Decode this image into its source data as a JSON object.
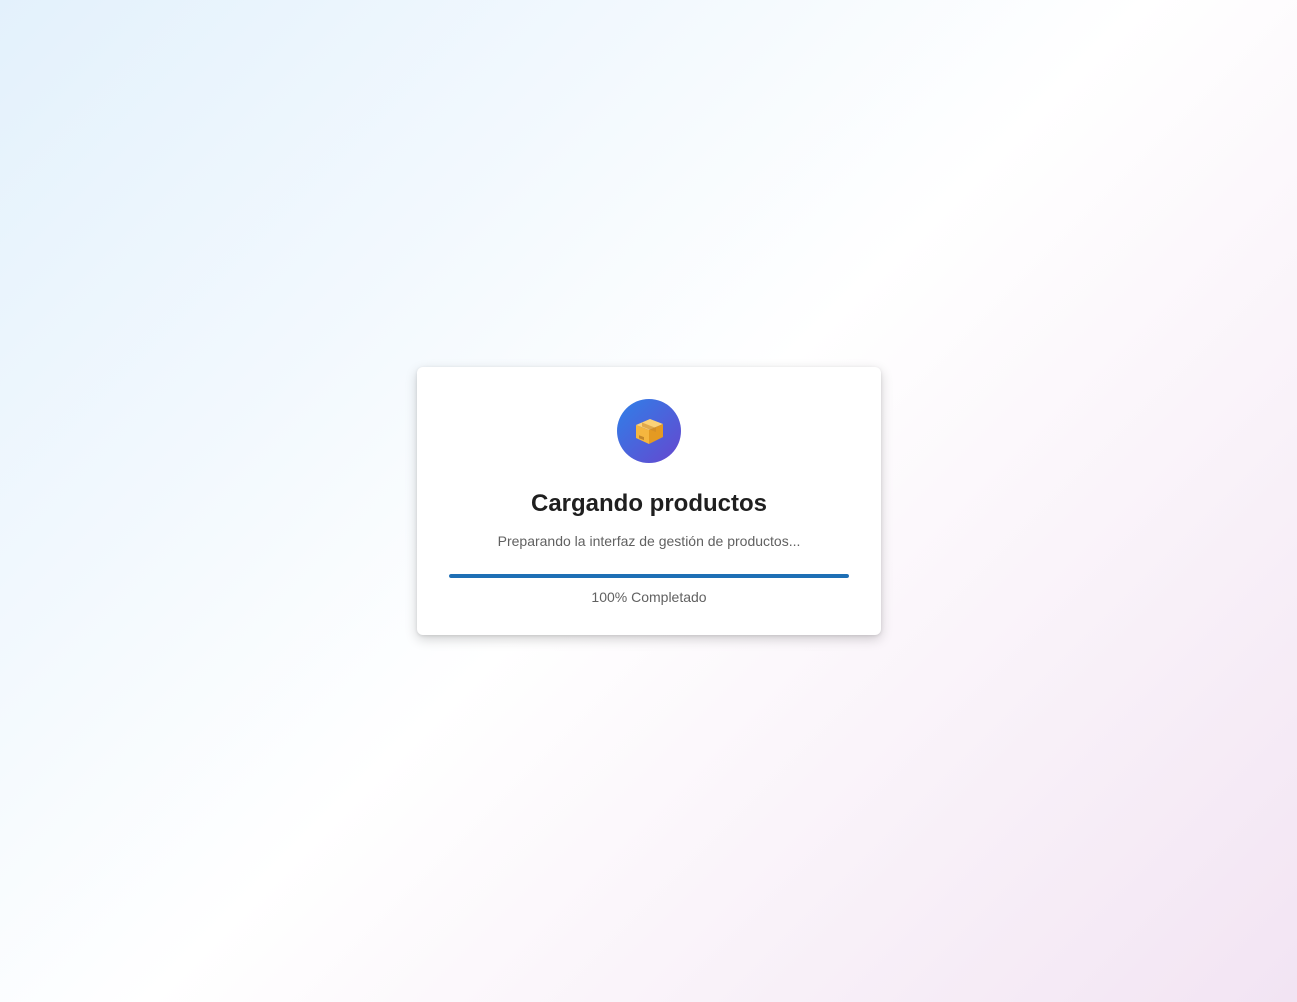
{
  "loader": {
    "icon": "package-icon",
    "title": "Cargando productos",
    "subtitle": "Preparando la interfaz de gestión de productos...",
    "progress": {
      "percent": 100,
      "label": "100% Completado"
    }
  },
  "colors": {
    "accent": "#1e6fb5",
    "icon_gradient_start": "#2f80e8",
    "icon_gradient_end": "#6647cf",
    "box": "#f5b63f"
  }
}
